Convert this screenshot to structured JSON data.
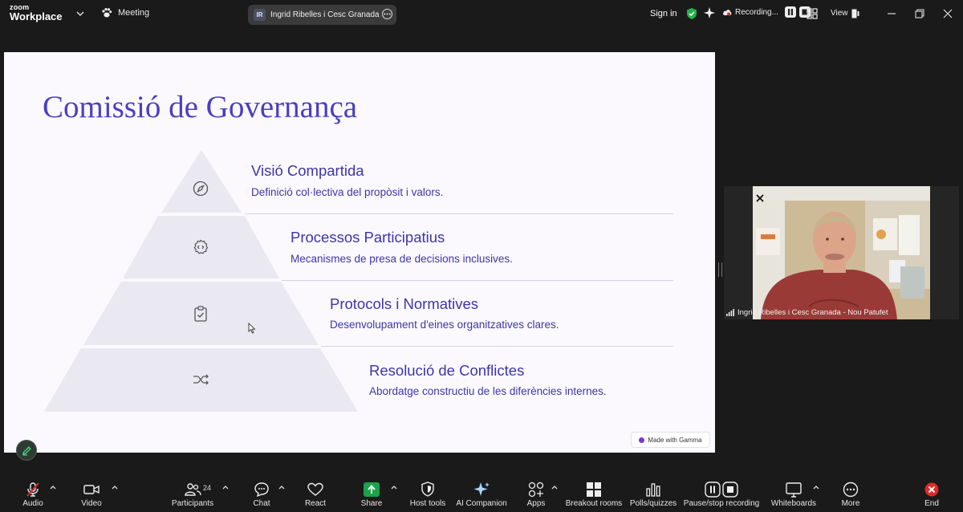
{
  "app": {
    "brand_top": "zoom",
    "brand_bottom": "Workplace"
  },
  "topbar": {
    "meeting_label": "Meeting",
    "meeting_initials": "IR",
    "meeting_title": "Ingrid Ribelles i Cesc Granada - Nou Patufet",
    "sign_in": "Sign in",
    "recording_label": "Recording...",
    "view_label": "View"
  },
  "slide": {
    "title": "Comissió de Governança",
    "tiers": [
      {
        "title": "Visió Compartida",
        "desc": "Definició col·lectiva del propòsit i valors.",
        "icon": "compass-icon"
      },
      {
        "title": "Processos Participatius",
        "desc": "Mecanismes de presa de decisions inclusives.",
        "icon": "code-gear-icon"
      },
      {
        "title": "Protocols i Normatives",
        "desc": "Desenvolupament d'eines organitzatives clares.",
        "icon": "clipboard-check-icon"
      },
      {
        "title": "Resolució de Conflictes",
        "desc": "Abordatge constructiu de les diferències internes.",
        "icon": "arrows-cross-icon"
      }
    ],
    "badge": "Made with Gamma",
    "accent": "#4a3fc1",
    "pyramid_fill": "#eae8f1"
  },
  "video": {
    "participant": "Ingrid Ribelles i Cesc Granada - Nou Patufet"
  },
  "toolbar": {
    "audio": "Audio",
    "video": "Video",
    "participants": "Participants",
    "participants_count": "24",
    "chat": "Chat",
    "react": "React",
    "share": "Share",
    "host_tools": "Host tools",
    "ai_companion": "AI Companion",
    "apps": "Apps",
    "breakout": "Breakout rooms",
    "polls": "Polls/quizzes",
    "pause_rec": "Pause/stop recording",
    "whiteboards": "Whiteboards",
    "more": "More",
    "end": "End"
  },
  "colors": {
    "share_green": "#1aa34a",
    "end_red": "#e02828",
    "shield_green": "#22b14c"
  }
}
